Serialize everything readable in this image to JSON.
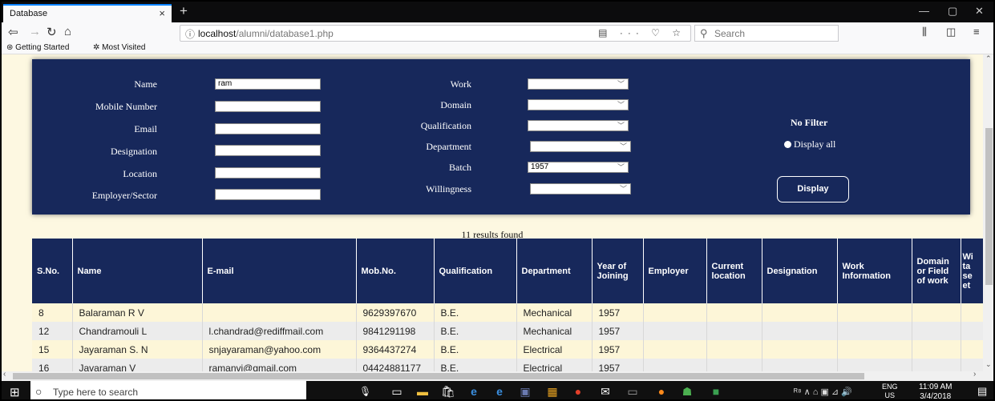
{
  "browser": {
    "tab_title": "Database",
    "tab_close": "×",
    "new_tab": "+",
    "url_info_icon": "ⓘ",
    "url_host": "localhost",
    "url_path": "/alumni/database1.php",
    "url_icons": "▤ ··· ♡ ☆",
    "search_placeholder": "Search",
    "bookmarks": [
      "Getting Started",
      "Most Visited"
    ],
    "min": "—",
    "max": "▢",
    "close": "✕"
  },
  "filter": {
    "labels_left": [
      "Name",
      "Mobile Number",
      "Email",
      "Designation",
      "Location",
      "Employer/Sector"
    ],
    "values_left": [
      "ram",
      "",
      "",
      "",
      "",
      ""
    ],
    "labels_mid": [
      "Work",
      "Domain",
      "Qualification",
      "Department",
      "Batch",
      "Willingness"
    ],
    "values_mid": [
      "",
      "",
      "",
      "",
      "1957",
      ""
    ],
    "no_filter": "No Filter",
    "display_all": "Display all",
    "display_button": "Display"
  },
  "results_text": "11 results found",
  "table": {
    "headers": [
      "S.No.",
      "Name",
      "E-mail",
      "Mob.No.",
      "Qualification",
      "Department",
      "Year of Joining",
      "Employer",
      "Current location",
      "Designation",
      "Work Information",
      "Domain or Field of work",
      "Wi ta se et"
    ],
    "rows": [
      [
        "8",
        "Balaraman R V",
        "",
        "9629397670",
        "B.E.",
        "Mechanical",
        "1957",
        "",
        "",
        "",
        "",
        "",
        ""
      ],
      [
        "12",
        "Chandramouli L",
        "l.chandrad@rediffmail.com",
        "9841291198",
        "B.E.",
        "Mechanical",
        "1957",
        "",
        "",
        "",
        "",
        "",
        ""
      ],
      [
        "15",
        "Jayaraman S. N",
        "snjayaraman@yahoo.com",
        "9364437274",
        "B.E.",
        "Electrical",
        "1957",
        "",
        "",
        "",
        "",
        "",
        ""
      ],
      [
        "16",
        "Javaraman V",
        "ramanvi@gmail.com",
        "04424881177",
        "B.E.",
        "Electrical",
        "1957",
        "",
        "",
        "",
        "",
        "",
        ""
      ]
    ]
  },
  "taskbar": {
    "search_text": "Type here to search",
    "lang_top": "ENG",
    "lang_bottom": "US",
    "time": "11:09 AM",
    "date": "3/4/2018"
  },
  "colors": {
    "panel": "#17285b",
    "content_bg": "#fdf8e1"
  }
}
